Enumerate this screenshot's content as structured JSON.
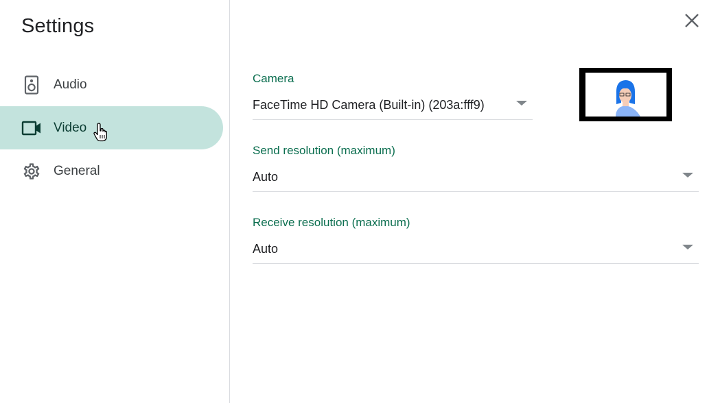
{
  "sidebar": {
    "title": "Settings",
    "items": [
      {
        "label": "Audio",
        "icon": "speaker-icon",
        "active": false
      },
      {
        "label": "Video",
        "icon": "video-camera-icon",
        "active": true
      },
      {
        "label": "General",
        "icon": "gear-icon",
        "active": false
      }
    ]
  },
  "close": {
    "icon": "close-icon"
  },
  "camera": {
    "label": "Camera",
    "value": "FaceTime HD Camera (Built-in) (203a:fff9)"
  },
  "send_resolution": {
    "label": "Send resolution (maximum)",
    "value": "Auto"
  },
  "receive_resolution": {
    "label": "Receive resolution (maximum)",
    "value": "Auto"
  },
  "colors": {
    "accent": "#0b6e4f",
    "active_bg": "#c3e3dd",
    "avatar_hair": "#1a73e8",
    "avatar_shirt": "#8ab4f8"
  }
}
